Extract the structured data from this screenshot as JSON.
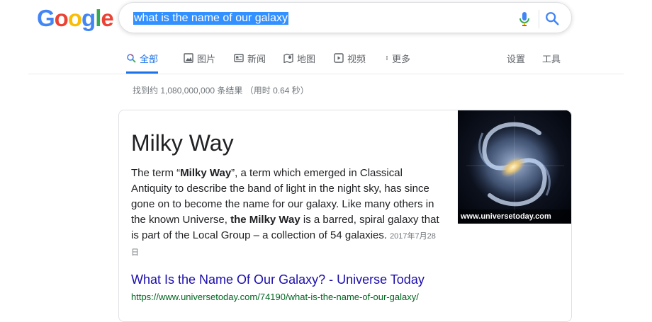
{
  "logo": {
    "letters": [
      "G",
      "o",
      "o",
      "g",
      "l",
      "e"
    ]
  },
  "search": {
    "query": "what is the name of our galaxy"
  },
  "tabs": [
    {
      "label": "全部",
      "icon": "search-icon"
    },
    {
      "label": "图片",
      "icon": "image-icon"
    },
    {
      "label": "新闻",
      "icon": "news-icon"
    },
    {
      "label": "地图",
      "icon": "map-pin-icon"
    },
    {
      "label": "视频",
      "icon": "video-icon"
    },
    {
      "label": "更多",
      "icon": "more-dots-icon"
    }
  ],
  "tools": {
    "settings": "设置",
    "tools": "工具"
  },
  "stats": "找到约 1,080,000,000 条结果 （用时 0.64 秒）",
  "featured": {
    "title": "Milky Way",
    "snippet_parts": [
      {
        "text": "The term “",
        "bold": false
      },
      {
        "text": "Milky Way",
        "bold": true
      },
      {
        "text": "”, a term which emerged in Classical Antiquity to describe the band of light in the night sky, has since gone on to become the name for our galaxy. Like many others in the known Universe, ",
        "bold": false
      },
      {
        "text": "the Milky Way",
        "bold": true
      },
      {
        "text": " is a barred, spiral galaxy that is part of the Local Group – a collection of 54 galaxies.",
        "bold": false
      }
    ],
    "date": "2017年7月28日",
    "image_caption": "www.universetoday.com",
    "result_title": "What Is the Name Of Our Galaxy? - Universe Today",
    "result_url": "https://www.universetoday.com/74190/what-is-the-name-of-our-galaxy/"
  },
  "colors": {
    "accent": "#1a73e8",
    "link": "#1a0dab",
    "url": "#006621"
  }
}
